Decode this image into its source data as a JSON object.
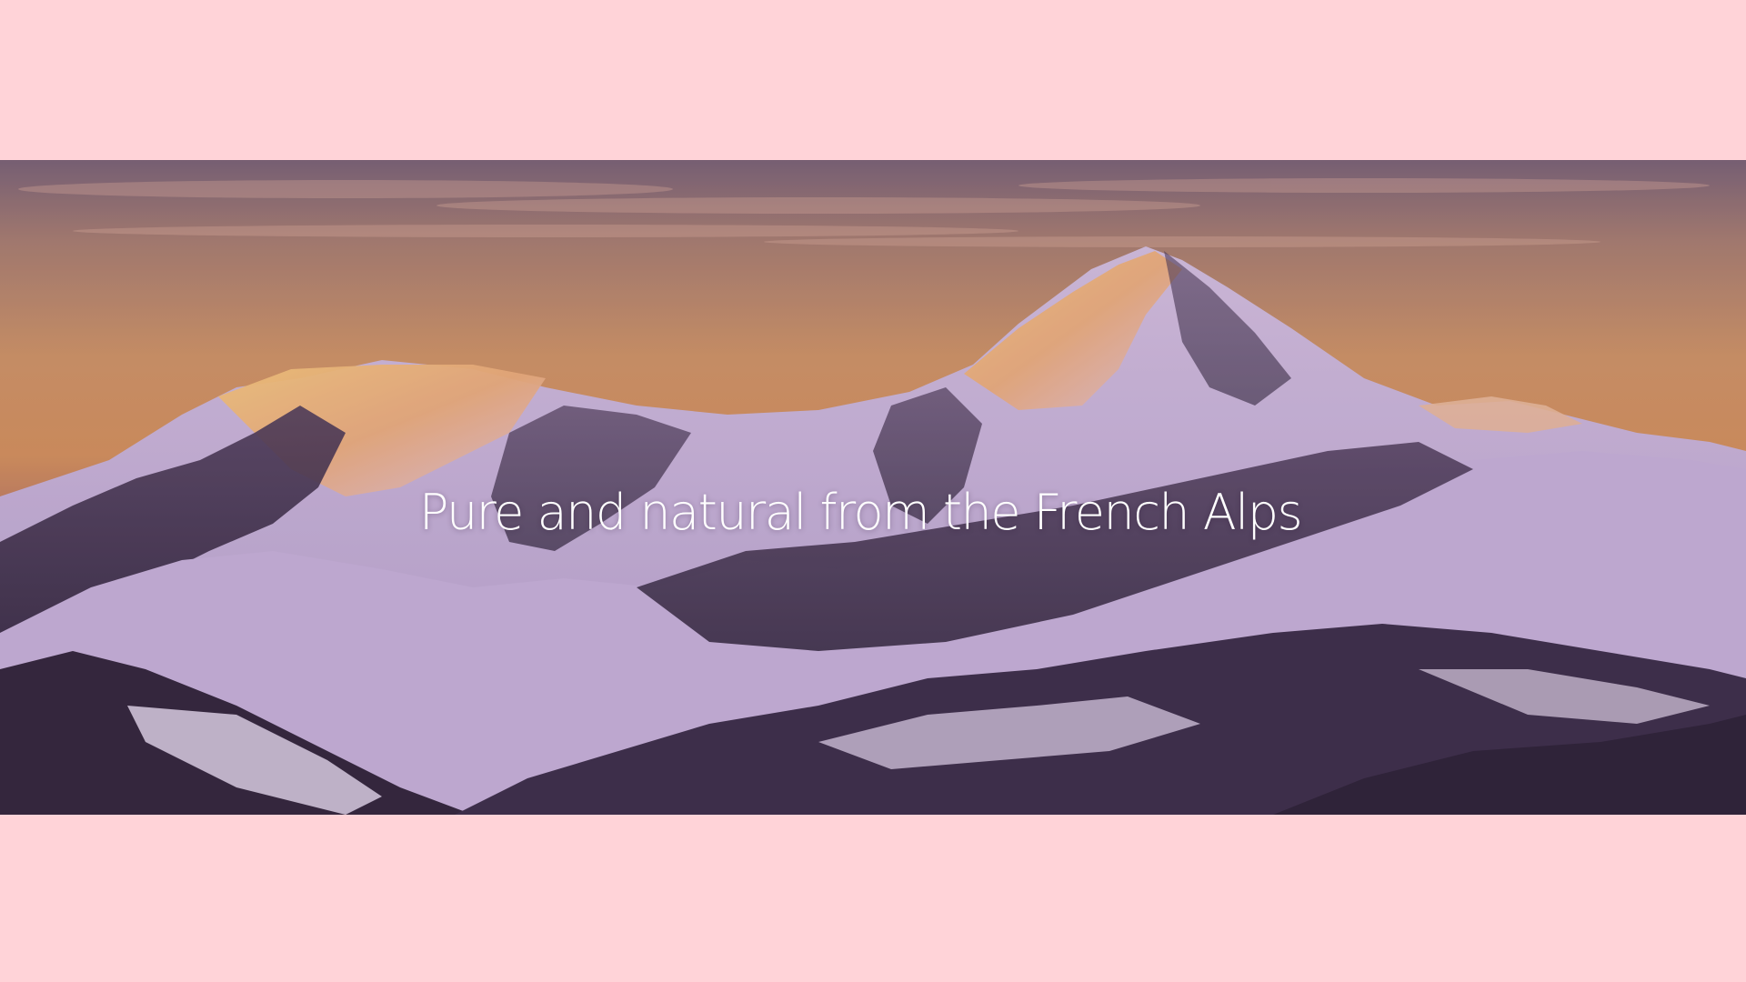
{
  "hero": {
    "headline": "Pure and natural from the French Alps",
    "image": {
      "subject": "mountain-range-at-sunset",
      "colors": {
        "page_background": "#ffd3d8",
        "sky_top": "#6e5a6e",
        "sky_glow": "#d99a5e",
        "sunlit_snow": "#f7b56a",
        "shadow_snow": "#c7b6dc",
        "rock": "#3a2f45"
      }
    }
  }
}
